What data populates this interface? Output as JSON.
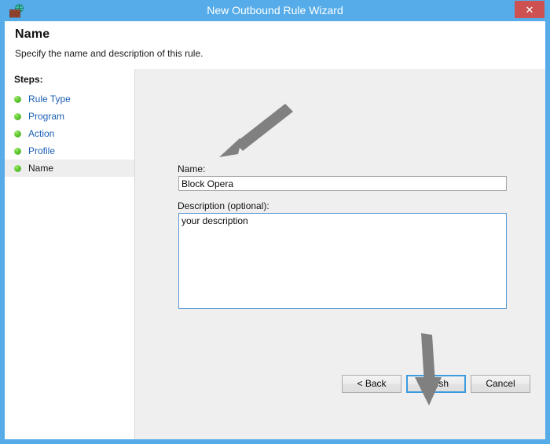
{
  "window": {
    "title": "New Outbound Rule Wizard",
    "icon": "firewall-icon",
    "close_label": "✕",
    "titlebar_color": "#55ace9",
    "close_color": "#cd5151"
  },
  "header": {
    "title": "Name",
    "subtitle": "Specify the name and description of this rule."
  },
  "sidebar": {
    "label": "Steps:",
    "items": [
      {
        "label": "Rule Type",
        "state": "done"
      },
      {
        "label": "Program",
        "state": "done"
      },
      {
        "label": "Action",
        "state": "done"
      },
      {
        "label": "Profile",
        "state": "done"
      },
      {
        "label": "Name",
        "state": "current"
      }
    ],
    "link_color": "#1a5fb4",
    "bullet_color": "#5fc92f"
  },
  "form": {
    "name_label": "Name:",
    "name_value": "Block Opera",
    "name_placeholder": "",
    "description_label": "Description (optional):",
    "description_value": "your description",
    "description_placeholder": ""
  },
  "buttons": {
    "back": "< Back",
    "finish": "Finish",
    "cancel": "Cancel",
    "focus_color": "#3c9ade"
  },
  "annotations": {
    "arrow_color": "#808080",
    "arrow_to_name": "arrow pointing to Name field",
    "arrow_to_finish": "arrow pointing to Finish button"
  }
}
